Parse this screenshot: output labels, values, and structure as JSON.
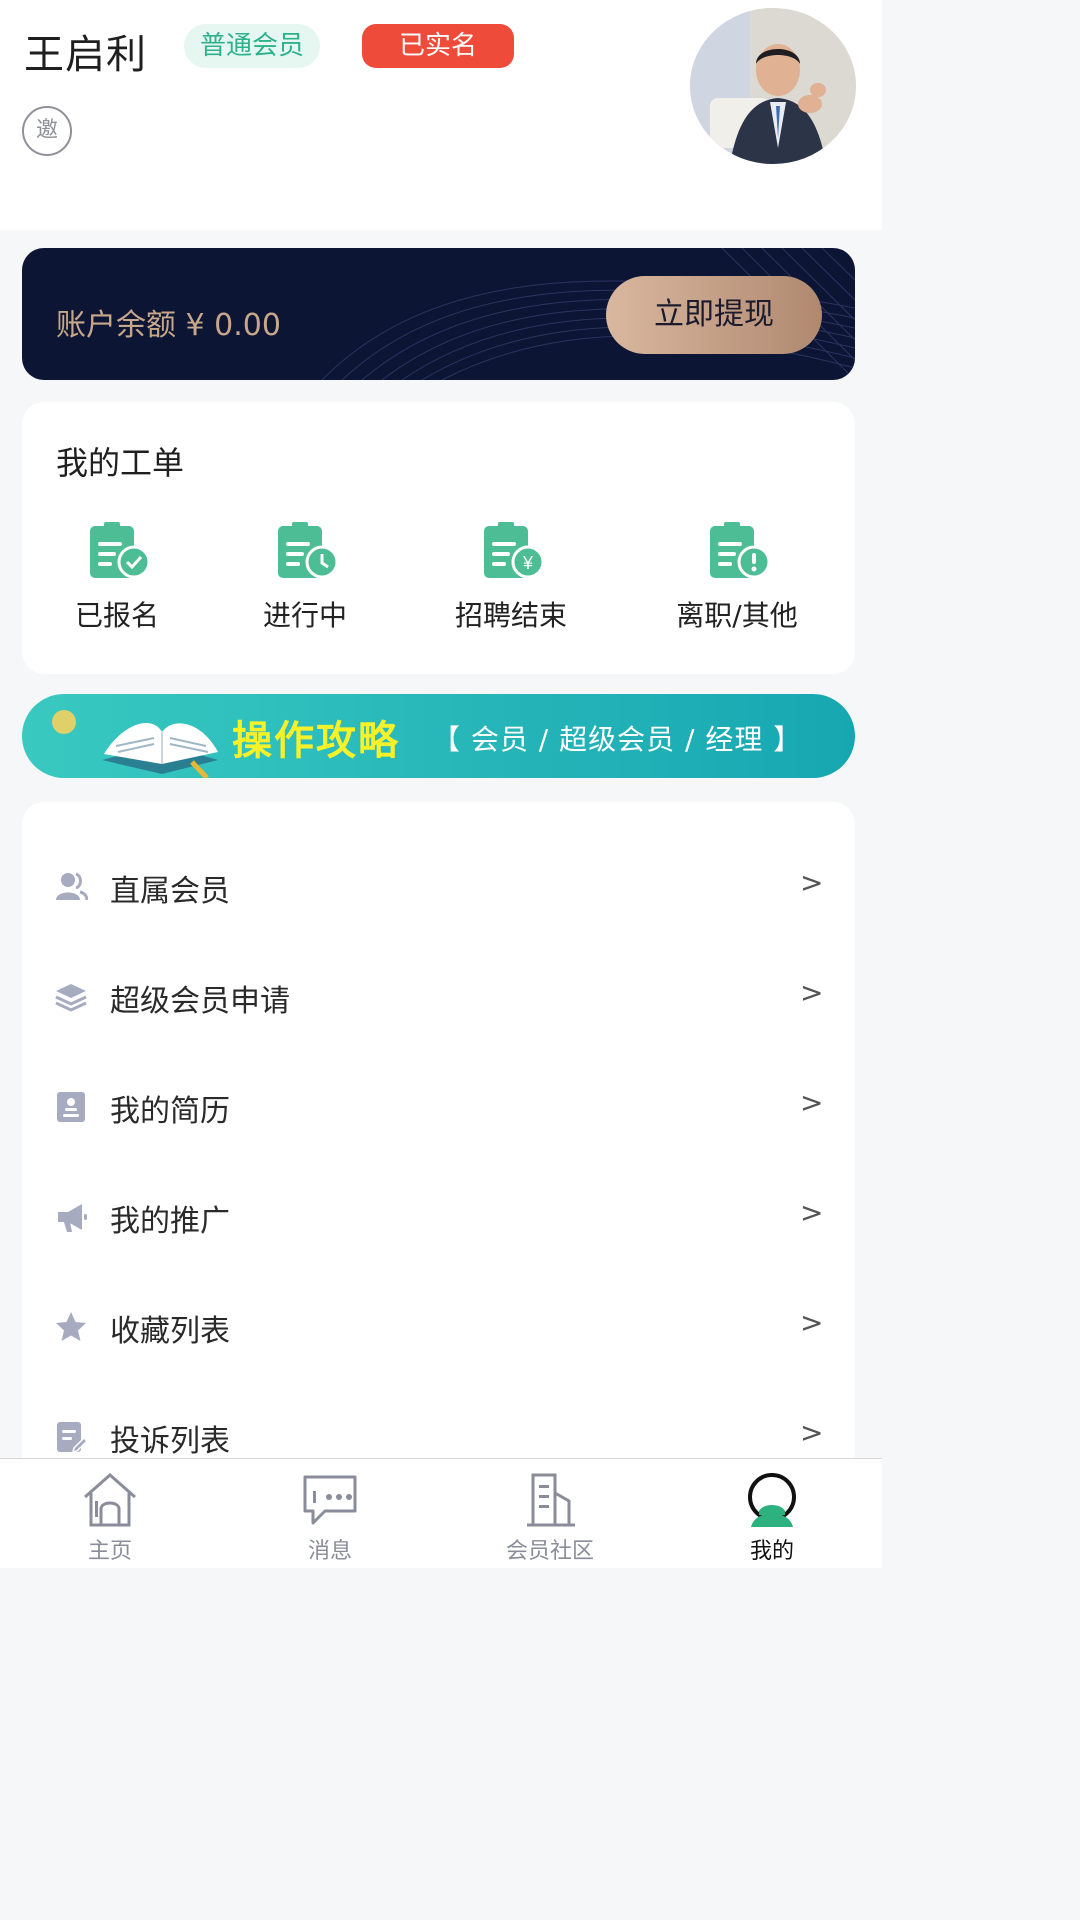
{
  "colors": {
    "accent": "#2eb28a",
    "verified": "#ee4b3a",
    "card_dark": "#0d1535",
    "gold": "#c7a78a",
    "icon_gray": "#a6abc0"
  },
  "profile": {
    "name": "王启利",
    "member_badge": "普通会员",
    "verified_badge": "已实名",
    "invite_icon_text": "邀"
  },
  "balance": {
    "label": "账户余额 ¥ 0.00",
    "withdraw_button": "立即提现"
  },
  "work_orders": {
    "title": "我的工单",
    "items": [
      {
        "label": "已报名",
        "icon": "clipboard-check-icon"
      },
      {
        "label": "进行中",
        "icon": "clipboard-clock-icon"
      },
      {
        "label": "招聘结束",
        "icon": "clipboard-yen-icon"
      },
      {
        "label": "离职/其他",
        "icon": "clipboard-alert-icon"
      }
    ]
  },
  "guide_banner": {
    "title": "操作攻略",
    "subtitle": "【 会员 / 超级会员 / 经理 】"
  },
  "menu": {
    "items": [
      {
        "label": "直属会员",
        "icon": "users-icon",
        "arrow": ">"
      },
      {
        "label": "超级会员申请",
        "icon": "layers-icon",
        "arrow": ">"
      },
      {
        "label": "我的简历",
        "icon": "resume-icon",
        "arrow": ">"
      },
      {
        "label": "我的推广",
        "icon": "megaphone-icon",
        "arrow": ">"
      },
      {
        "label": "收藏列表",
        "icon": "star-icon",
        "arrow": ">"
      },
      {
        "label": "投诉列表",
        "icon": "complaint-icon",
        "arrow": ">"
      }
    ]
  },
  "tabbar": {
    "items": [
      {
        "label": "主页",
        "icon": "home-icon"
      },
      {
        "label": "消息",
        "icon": "message-icon"
      },
      {
        "label": "会员社区",
        "icon": "building-icon"
      },
      {
        "label": "我的",
        "icon": "profile-icon"
      }
    ],
    "active_index": 3
  }
}
